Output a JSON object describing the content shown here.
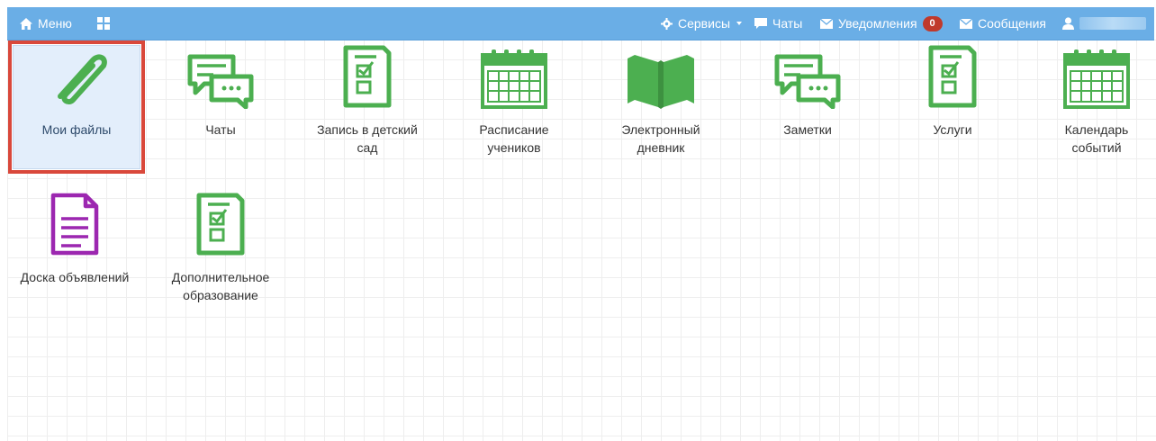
{
  "navbar": {
    "menu_label": "Меню",
    "services_label": "Сервисы",
    "chats_label": "Чаты",
    "notifications_label": "Уведомления",
    "notifications_count": "0",
    "messages_label": "Сообщения"
  },
  "tiles": [
    {
      "label_line1": "Мои файлы",
      "label_line2": "",
      "icon": "paperclip-icon"
    },
    {
      "label_line1": "Чаты",
      "label_line2": "",
      "icon": "chat-bubbles-icon"
    },
    {
      "label_line1": "Запись в детский",
      "label_line2": "сад",
      "icon": "checklist-document-icon"
    },
    {
      "label_line1": "Расписание",
      "label_line2": "учеников",
      "icon": "calendar-icon"
    },
    {
      "label_line1": "Электронный",
      "label_line2": "дневник",
      "icon": "open-book-icon"
    },
    {
      "label_line1": "Заметки",
      "label_line2": "",
      "icon": "chat-bubbles-icon"
    },
    {
      "label_line1": "Услуги",
      "label_line2": "",
      "icon": "checklist-document-icon"
    },
    {
      "label_line1": "Календарь",
      "label_line2": "событий",
      "icon": "calendar-icon"
    },
    {
      "label_line1": "Доска объявлений",
      "label_line2": "",
      "icon": "document-lines-icon"
    },
    {
      "label_line1": "Дополнительное",
      "label_line2": "образование",
      "icon": "checklist-document-icon"
    }
  ],
  "colors": {
    "navbar": "#6aaee6",
    "icon_green": "#4caf50",
    "icon_purple": "#9c27b0",
    "selection_border": "#d9483b",
    "selection_fill": "#e3eefb",
    "badge": "#c0392b"
  }
}
